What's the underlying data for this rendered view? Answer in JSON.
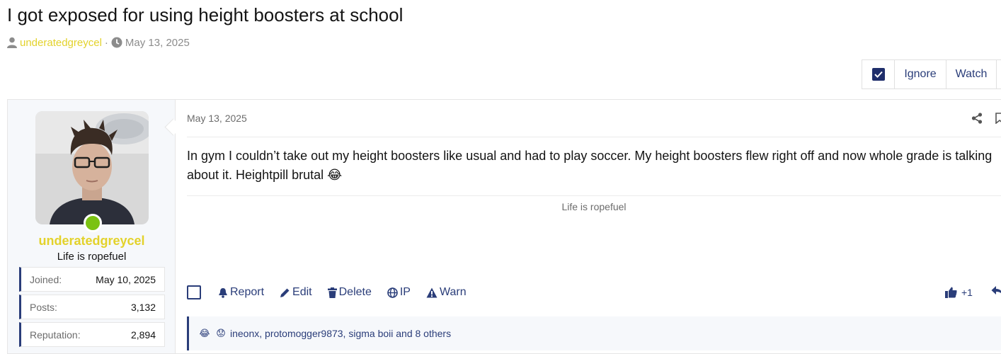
{
  "thread": {
    "title": "I got exposed for using height boosters at school",
    "author": "underatedgreycel",
    "separator": "·",
    "date": "May 13, 2025"
  },
  "actionbar": {
    "ignore": "Ignore",
    "watch": "Watch"
  },
  "sidebar": {
    "username": "underatedgreycel",
    "user_title": "Life is ropefuel",
    "stats": [
      {
        "key": "Joined:",
        "value": "May 10, 2025"
      },
      {
        "key": "Posts:",
        "value": "3,132"
      },
      {
        "key": "Reputation:",
        "value": "2,894"
      }
    ]
  },
  "post": {
    "date": "May 13, 2025",
    "body": "In gym I couldn’t take out my height boosters like usual and had to play soccer. My height boosters flew right off and now whole grade is talking about it. Heightpill brutal",
    "emoji": "😂",
    "signature": "Life is ropefuel",
    "actions": {
      "report": "Report",
      "edit": "Edit",
      "delete": "Delete",
      "ip": "IP",
      "warn": "Warn"
    },
    "reaction_count": "+1",
    "reactions_summary": "ineonx, protomogger9873, sigma boii and 8 others",
    "reaction_emojis": [
      "😂",
      "😟"
    ]
  },
  "colors": {
    "username": "#e3d22b",
    "link": "#2a3d79",
    "online": "#7bc212"
  }
}
